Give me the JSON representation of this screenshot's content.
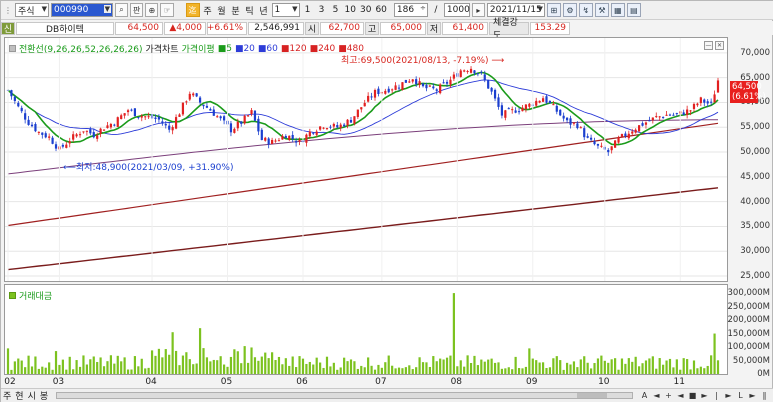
{
  "toolbar": {
    "market_type": "주식",
    "stock_code": "000990",
    "search_label": "⌕",
    "btn_pan": "판",
    "btn_chart": "⊕",
    "btn_hand": "☞",
    "btn_ma": "迄",
    "periods": [
      "주",
      "월",
      "분",
      "틱",
      "년"
    ],
    "tick_value": "1",
    "tick_options": [
      "1",
      "3",
      "5",
      "10",
      "30",
      "60"
    ],
    "count_value": "186",
    "count_total": "1000",
    "date_value": "2021/11/15"
  },
  "infobar": {
    "tag": "신",
    "stock_name": "DB하이텍",
    "price": "64,500",
    "change": "▲4,000",
    "change_pct": "+6.61%",
    "volume": "2,546,991",
    "open_label": "시",
    "open": "62,700",
    "high_label": "고",
    "high": "65,000",
    "low_label": "저",
    "low": "61,400",
    "strength_label": "체결강도",
    "strength": "153.29"
  },
  "legend": {
    "ichimoku": "전환선(9,26,26,52,26,26,26)",
    "price_chart": "가격차트",
    "ma_label": "가격이평",
    "ma_periods": [
      {
        "label": "5",
        "color": "#1a9b1a"
      },
      {
        "label": "20",
        "color": "#2d3cd8"
      },
      {
        "label": "60",
        "color": "#2d3cd8"
      },
      {
        "label": "120",
        "color": "#d72222"
      },
      {
        "label": "240",
        "color": "#d72222"
      },
      {
        "label": "480",
        "color": "#d72222"
      }
    ],
    "volume_label": "거래대금"
  },
  "annotations": {
    "high": "최고:69,500(2021/08/13, -7.19%)",
    "low": "최저:48,900(2021/03/09, +31.90%)"
  },
  "price_axis": [
    "70,000",
    "65,000",
    "60,000",
    "55,000",
    "50,000",
    "45,000",
    "40,000",
    "35,000",
    "30,000",
    "25,000"
  ],
  "volume_axis": [
    "300,000M",
    "250,000M",
    "200,000M",
    "150,000M",
    "100,000M",
    "50,000M",
    "0M"
  ],
  "last_price_label": [
    "64,500",
    "(6.61%)"
  ],
  "x_months": [
    "02",
    "03",
    "04",
    "05",
    "06",
    "07",
    "08",
    "09",
    "10",
    "11"
  ],
  "bottom": {
    "labels": [
      "주",
      "현",
      "시",
      "봉"
    ],
    "nav": [
      "A",
      "◄",
      "+",
      "◄",
      "■",
      "►",
      "|",
      "►",
      "L",
      "►",
      "∥"
    ]
  },
  "colors": {
    "up": "#e22020",
    "down": "#1b3fcf",
    "volume": "#7cc21f",
    "conversion": "#1a9b1a",
    "baseline": "#2d3cd8",
    "ma120": "#e05050",
    "ma240": "#a02020",
    "ma480": "#7a1c1c"
  },
  "chart_data": {
    "type": "candlestick",
    "price_range": [
      24000,
      73000
    ],
    "volume_range": [
      0,
      330000
    ],
    "month_starts": [
      0,
      15,
      42,
      64,
      86,
      109,
      131,
      153,
      174,
      196
    ],
    "close_trajectory": [
      [
        0,
        62500
      ],
      [
        3,
        59000
      ],
      [
        6,
        56000
      ],
      [
        9,
        54000
      ],
      [
        12,
        53000
      ],
      [
        15,
        50500
      ],
      [
        18,
        52500
      ],
      [
        22,
        54500
      ],
      [
        25,
        53500
      ],
      [
        28,
        55000
      ],
      [
        31,
        56000
      ],
      [
        35,
        58500
      ],
      [
        38,
        57500
      ],
      [
        41,
        57000
      ],
      [
        44,
        56500
      ],
      [
        47,
        54500
      ],
      [
        50,
        58000
      ],
      [
        53,
        62000
      ],
      [
        56,
        60000
      ],
      [
        59,
        58500
      ],
      [
        62,
        56500
      ],
      [
        65,
        54500
      ],
      [
        68,
        56000
      ],
      [
        71,
        58000
      ],
      [
        74,
        52500
      ],
      [
        77,
        52000
      ],
      [
        81,
        53500
      ],
      [
        85,
        52000
      ],
      [
        88,
        54000
      ],
      [
        92,
        55500
      ],
      [
        96,
        55000
      ],
      [
        100,
        56500
      ],
      [
        104,
        60000
      ],
      [
        107,
        62000
      ],
      [
        110,
        62500
      ],
      [
        114,
        63500
      ],
      [
        118,
        65000
      ],
      [
        121,
        63000
      ],
      [
        125,
        62500
      ],
      [
        129,
        64500
      ],
      [
        132,
        66500
      ],
      [
        135,
        67000
      ],
      [
        138,
        65500
      ],
      [
        141,
        62000
      ],
      [
        144,
        57500
      ],
      [
        148,
        58500
      ],
      [
        152,
        59500
      ],
      [
        156,
        61000
      ],
      [
        159,
        59000
      ],
      [
        163,
        56000
      ],
      [
        166,
        55500
      ],
      [
        169,
        52500
      ],
      [
        172,
        51000
      ],
      [
        175,
        50000
      ],
      [
        178,
        52500
      ],
      [
        182,
        54500
      ],
      [
        186,
        56000
      ],
      [
        189,
        57000
      ],
      [
        192,
        57500
      ],
      [
        195,
        57500
      ],
      [
        199,
        58500
      ],
      [
        202,
        60500
      ],
      [
        205,
        59500
      ],
      [
        207,
        64500
      ]
    ],
    "ma120_range": [
      45600,
      56500
    ],
    "ma240_range": [
      35200,
      55800
    ],
    "ma480_range": [
      26300,
      42800
    ],
    "volume_peaks": [
      {
        "i": 0,
        "v": 95000
      },
      {
        "i": 14,
        "v": 85000
      },
      {
        "i": 48,
        "v": 155000
      },
      {
        "i": 56,
        "v": 170000
      },
      {
        "i": 130,
        "v": 300000
      },
      {
        "i": 152,
        "v": 95000
      },
      {
        "i": 206,
        "v": 150000
      }
    ],
    "high_point": {
      "value": 69500,
      "date": "2021/08/13",
      "pct": -7.19
    },
    "low_point": {
      "value": 48900,
      "date": "2021/03/09",
      "pct": 31.9
    }
  }
}
